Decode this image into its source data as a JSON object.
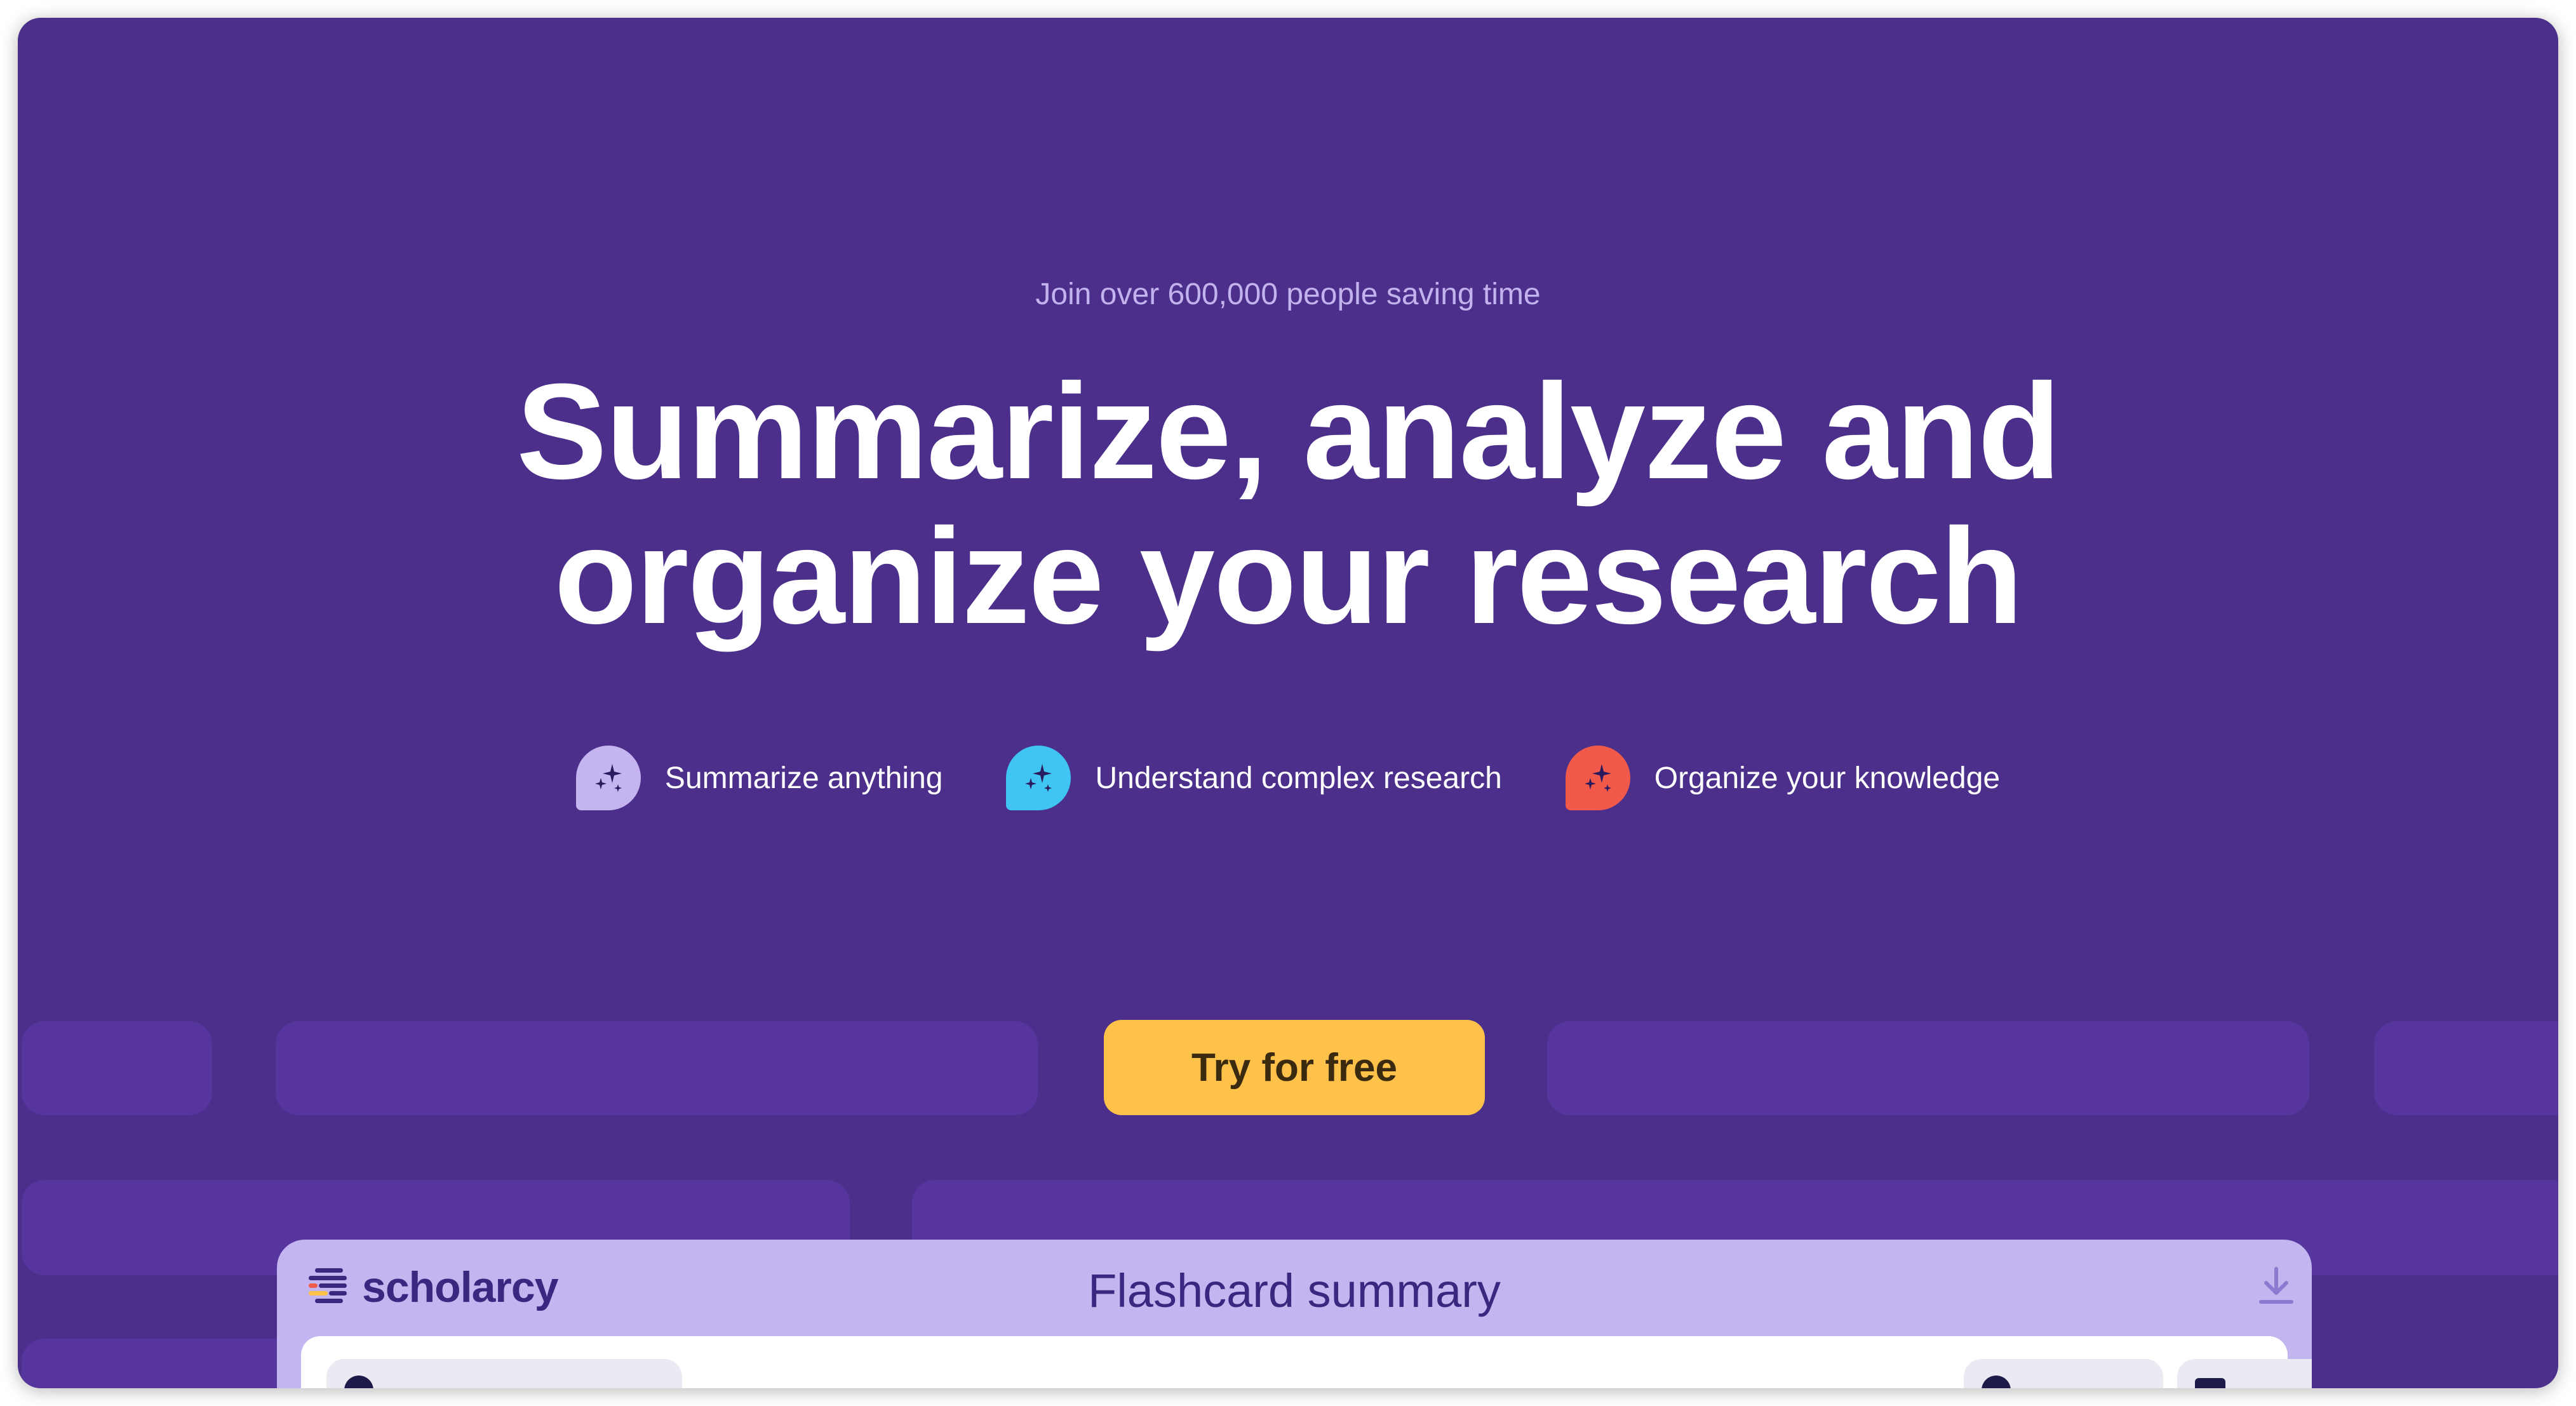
{
  "hero": {
    "kicker": "Join over 600,000 people saving time",
    "headline_line1": "Summarize, analyze and",
    "headline_line2": "organize your research"
  },
  "features": [
    {
      "label": "Summarize anything",
      "icon": "sparkle-bubble-icon",
      "color": "#c4b4f0"
    },
    {
      "label": "Understand complex research",
      "icon": "sparkle-bubble-icon",
      "color": "#40c4f1"
    },
    {
      "label": "Organize your knowledge",
      "icon": "sparkle-bubble-icon",
      "color": "#f15a4a"
    }
  ],
  "cta": {
    "label": "Try for free",
    "color": "#fec14a"
  },
  "app_preview": {
    "logo_text": "scholarcy",
    "title": "Flashcard summary",
    "download_icon": "download-icon"
  },
  "colors": {
    "background": "#4b2f8a",
    "pill": "#57359f",
    "app_header": "#c3b5f0",
    "brand_text": "#3b2780"
  }
}
